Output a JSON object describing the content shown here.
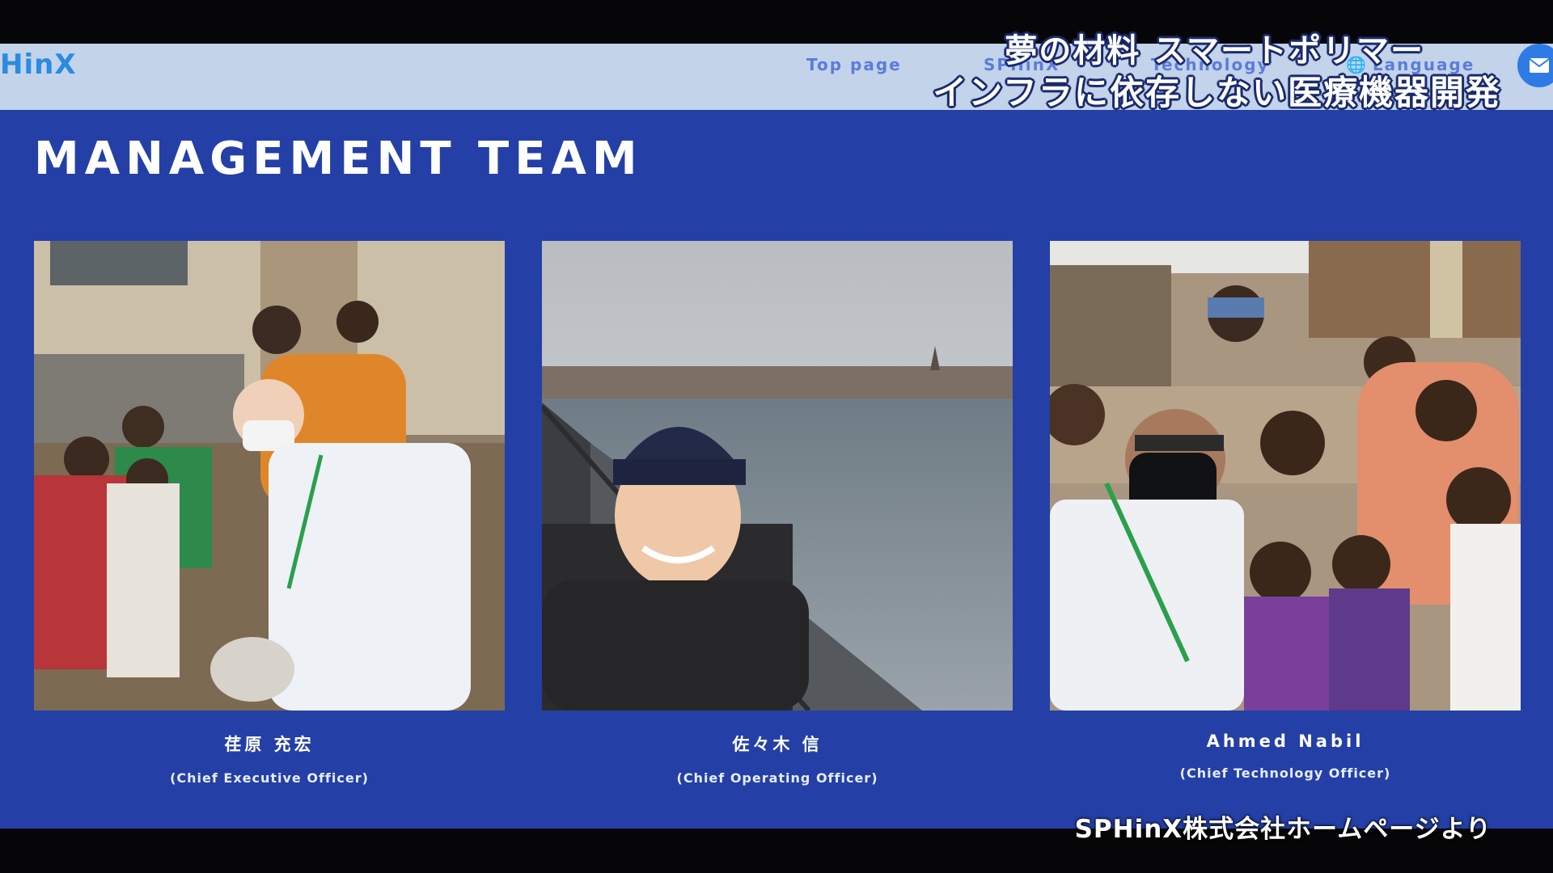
{
  "navbar": {
    "logo": "HinX",
    "items": [
      {
        "label": "Top page"
      },
      {
        "label": "SPHinX"
      },
      {
        "label": "Technology"
      },
      {
        "label": "Language",
        "icon": "globe-icon"
      }
    ],
    "mail_icon": "mail-icon"
  },
  "main": {
    "title": "MANAGEMENT TEAM",
    "members": [
      {
        "name": "荏原 充宏",
        "role": "(Chief Executive Officer)"
      },
      {
        "name": "佐々木 信",
        "role": "(Chief Operating Officer)"
      },
      {
        "name": "Ahmed Nabil",
        "role": "(Chief Technology Officer)"
      }
    ]
  },
  "overlay": {
    "line1": "夢の材料 スマートポリマー",
    "line2": "インフラに依存しない医療機器開発",
    "source": "SPHinX株式会社ホームページより"
  },
  "colors": {
    "navbar_bg": "#c2d3ea",
    "main_bg": "#2440a6",
    "accent": "#2f7be6"
  }
}
